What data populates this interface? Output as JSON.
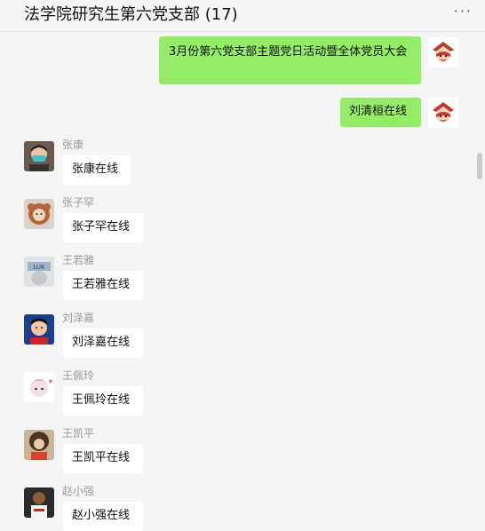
{
  "header": {
    "title": "法学院研究生第六党支部 (17)",
    "more_label": "···"
  },
  "messages_out": [
    {
      "text": "3月份第六党支部主题党日活动暨全体党员大会",
      "avatar_icon": "lion-mask-avatar-icon"
    },
    {
      "text": "刘清桓在线",
      "avatar_icon": "lion-mask-avatar-icon"
    }
  ],
  "messages_in": [
    {
      "sender": "张康",
      "text": "张康在线"
    },
    {
      "sender": "张子罕",
      "text": "张子罕在线"
    },
    {
      "sender": "王若雅",
      "text": "王若雅在线"
    },
    {
      "sender": "刘泽嘉",
      "text": "刘泽嘉在线"
    },
    {
      "sender": "王佩玲",
      "text": "王佩玲在线"
    },
    {
      "sender": "王凯平",
      "text": "王凯平在线"
    },
    {
      "sender": "赵小强",
      "text": "赵小强在线"
    }
  ],
  "colors": {
    "outgoing_bubble": "#95ec69",
    "incoming_bubble": "#ffffff",
    "background": "#f5f5f5"
  }
}
